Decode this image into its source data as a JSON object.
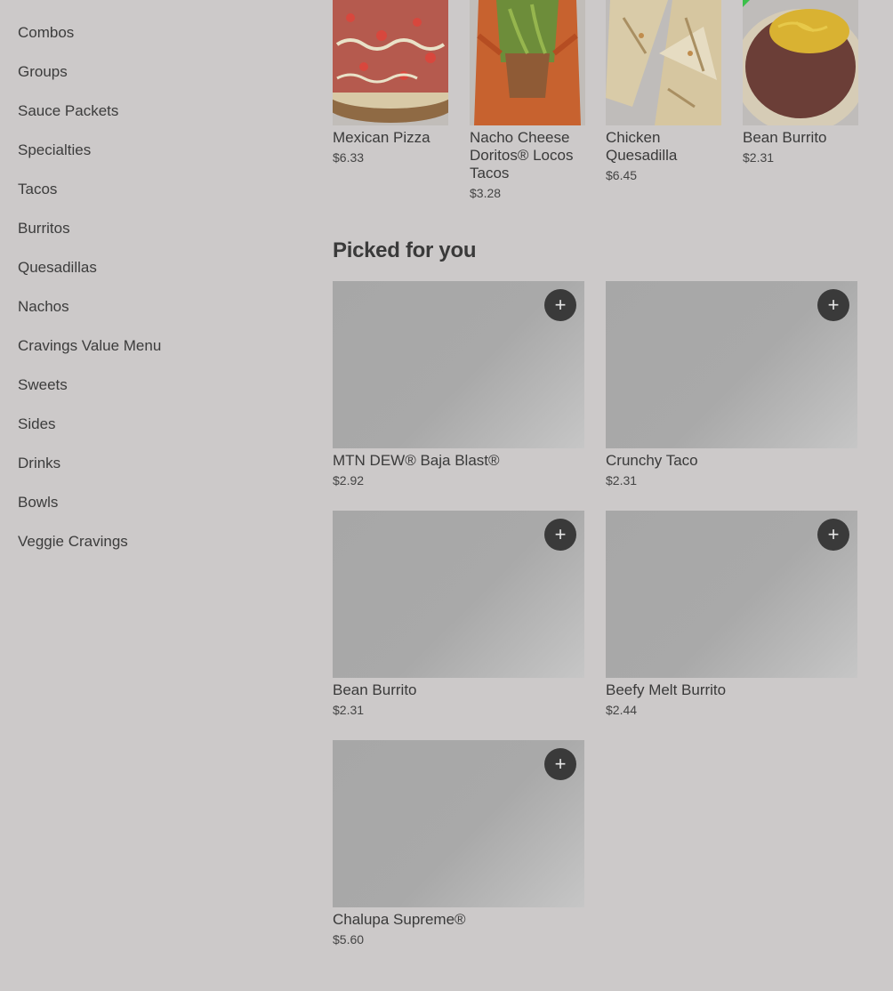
{
  "sidebar": {
    "items": [
      {
        "label": "Combos"
      },
      {
        "label": "Groups"
      },
      {
        "label": "Sauce Packets"
      },
      {
        "label": "Specialties"
      },
      {
        "label": "Tacos"
      },
      {
        "label": "Burritos"
      },
      {
        "label": "Quesadillas"
      },
      {
        "label": "Nachos"
      },
      {
        "label": "Cravings Value Menu"
      },
      {
        "label": "Sweets"
      },
      {
        "label": "Sides"
      },
      {
        "label": "Drinks"
      },
      {
        "label": "Bowls"
      },
      {
        "label": "Veggie Cravings"
      }
    ]
  },
  "top_items": [
    {
      "name": "Mexican Pizza",
      "price": "$6.33"
    },
    {
      "name": "Nacho Cheese Doritos® Locos Tacos",
      "price": "$3.28"
    },
    {
      "name": "Chicken Quesadilla",
      "price": "$6.45"
    },
    {
      "name": "Bean Burrito",
      "price": "$2.31"
    }
  ],
  "picked": {
    "title": "Picked for you",
    "add_label": "+",
    "items": [
      {
        "name": "MTN DEW® Baja Blast®",
        "price": "$2.92"
      },
      {
        "name": "Crunchy Taco",
        "price": "$2.31"
      },
      {
        "name": "Bean Burrito",
        "price": "$2.31"
      },
      {
        "name": "Beefy Melt Burrito",
        "price": "$2.44"
      },
      {
        "name": "Chalupa Supreme®",
        "price": "$5.60"
      }
    ]
  },
  "colors": {
    "overlay_bg": "#ccc9c9",
    "add_button": "#3a3a3a"
  }
}
